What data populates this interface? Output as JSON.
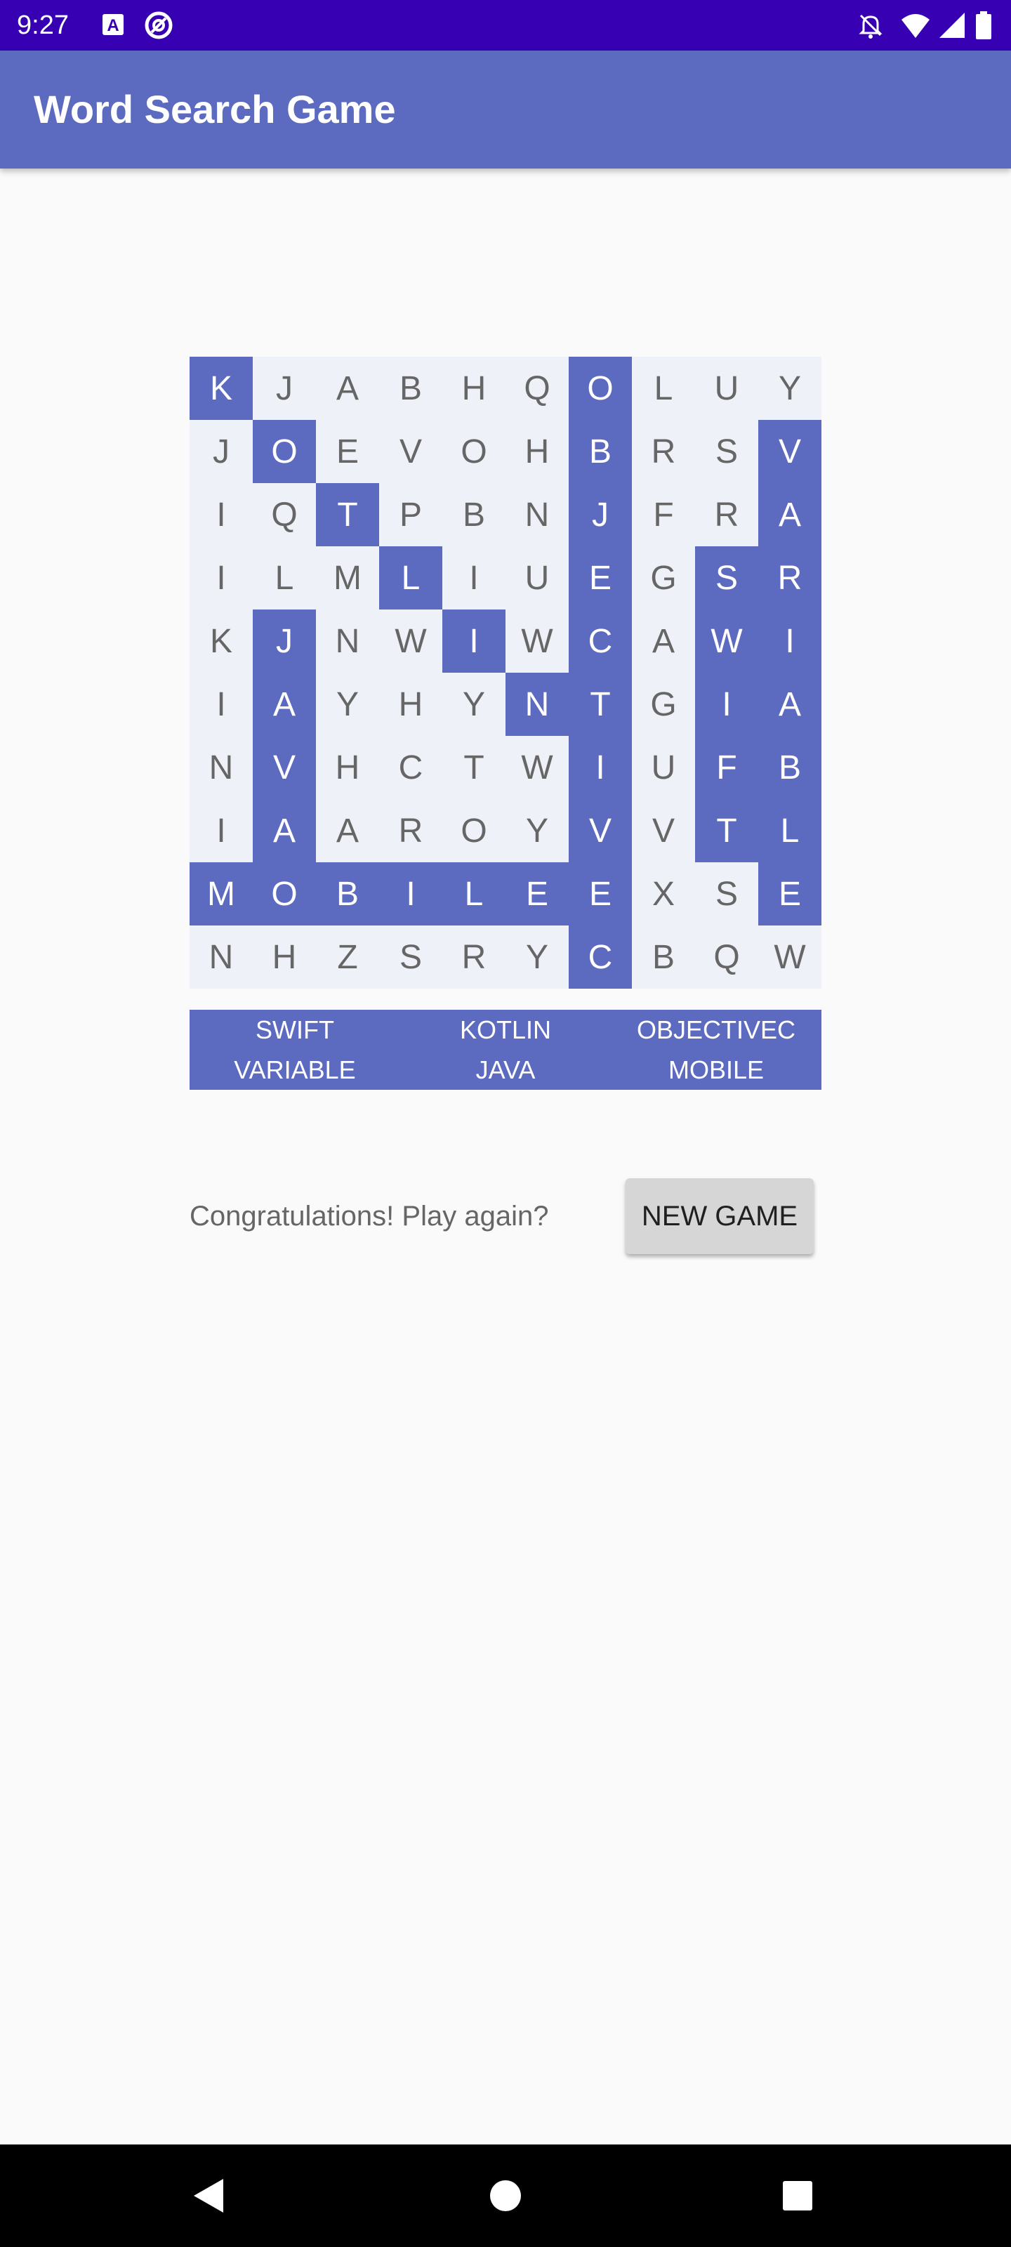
{
  "status_bar": {
    "time": "9:27",
    "bg_color": "#3700b3",
    "icons_left": [
      "font-a-icon",
      "at-sign-icon"
    ],
    "icons_right": [
      "mute-bell-icon",
      "wifi-icon",
      "cell-signal-icon",
      "battery-icon"
    ]
  },
  "app": {
    "title": "Word Search Game",
    "accent_color": "#5c6bc0"
  },
  "grid": {
    "rows": [
      [
        "K",
        "J",
        "A",
        "B",
        "H",
        "Q",
        "O",
        "L",
        "U",
        "Y"
      ],
      [
        "J",
        "O",
        "E",
        "V",
        "O",
        "H",
        "B",
        "R",
        "S",
        "V"
      ],
      [
        "I",
        "Q",
        "T",
        "P",
        "B",
        "N",
        "J",
        "F",
        "R",
        "A"
      ],
      [
        "I",
        "L",
        "M",
        "L",
        "I",
        "U",
        "E",
        "G",
        "S",
        "R"
      ],
      [
        "K",
        "J",
        "N",
        "W",
        "I",
        "W",
        "C",
        "A",
        "W",
        "I"
      ],
      [
        "I",
        "A",
        "Y",
        "H",
        "Y",
        "N",
        "T",
        "G",
        "I",
        "A"
      ],
      [
        "N",
        "V",
        "H",
        "C",
        "T",
        "W",
        "I",
        "U",
        "F",
        "B"
      ],
      [
        "I",
        "A",
        "A",
        "R",
        "O",
        "Y",
        "V",
        "V",
        "T",
        "L"
      ],
      [
        "M",
        "O",
        "B",
        "I",
        "L",
        "E",
        "E",
        "X",
        "S",
        "E"
      ],
      [
        "N",
        "H",
        "Z",
        "S",
        "R",
        "Y",
        "C",
        "B",
        "Q",
        "W"
      ]
    ],
    "highlighted": [
      [
        true,
        false,
        false,
        false,
        false,
        false,
        true,
        false,
        false,
        false
      ],
      [
        false,
        true,
        false,
        false,
        false,
        false,
        true,
        false,
        false,
        true
      ],
      [
        false,
        false,
        true,
        false,
        false,
        false,
        true,
        false,
        false,
        true
      ],
      [
        false,
        false,
        false,
        true,
        false,
        false,
        true,
        false,
        true,
        true
      ],
      [
        false,
        true,
        false,
        false,
        true,
        false,
        true,
        false,
        true,
        true
      ],
      [
        false,
        true,
        false,
        false,
        false,
        true,
        true,
        false,
        true,
        true
      ],
      [
        false,
        true,
        false,
        false,
        false,
        false,
        true,
        false,
        true,
        true
      ],
      [
        false,
        true,
        false,
        false,
        false,
        false,
        true,
        false,
        true,
        true
      ],
      [
        true,
        true,
        true,
        true,
        true,
        true,
        true,
        false,
        false,
        true
      ],
      [
        false,
        false,
        false,
        false,
        false,
        false,
        true,
        false,
        false,
        false
      ]
    ]
  },
  "words": [
    "SWIFT",
    "KOTLIN",
    "OBJECTIVEC",
    "VARIABLE",
    "JAVA",
    "MOBILE"
  ],
  "message": "Congratulations! Play again?",
  "new_game_label": "NEW GAME",
  "nav_bar": {
    "icons": [
      "back-icon",
      "home-icon",
      "recents-icon"
    ]
  }
}
